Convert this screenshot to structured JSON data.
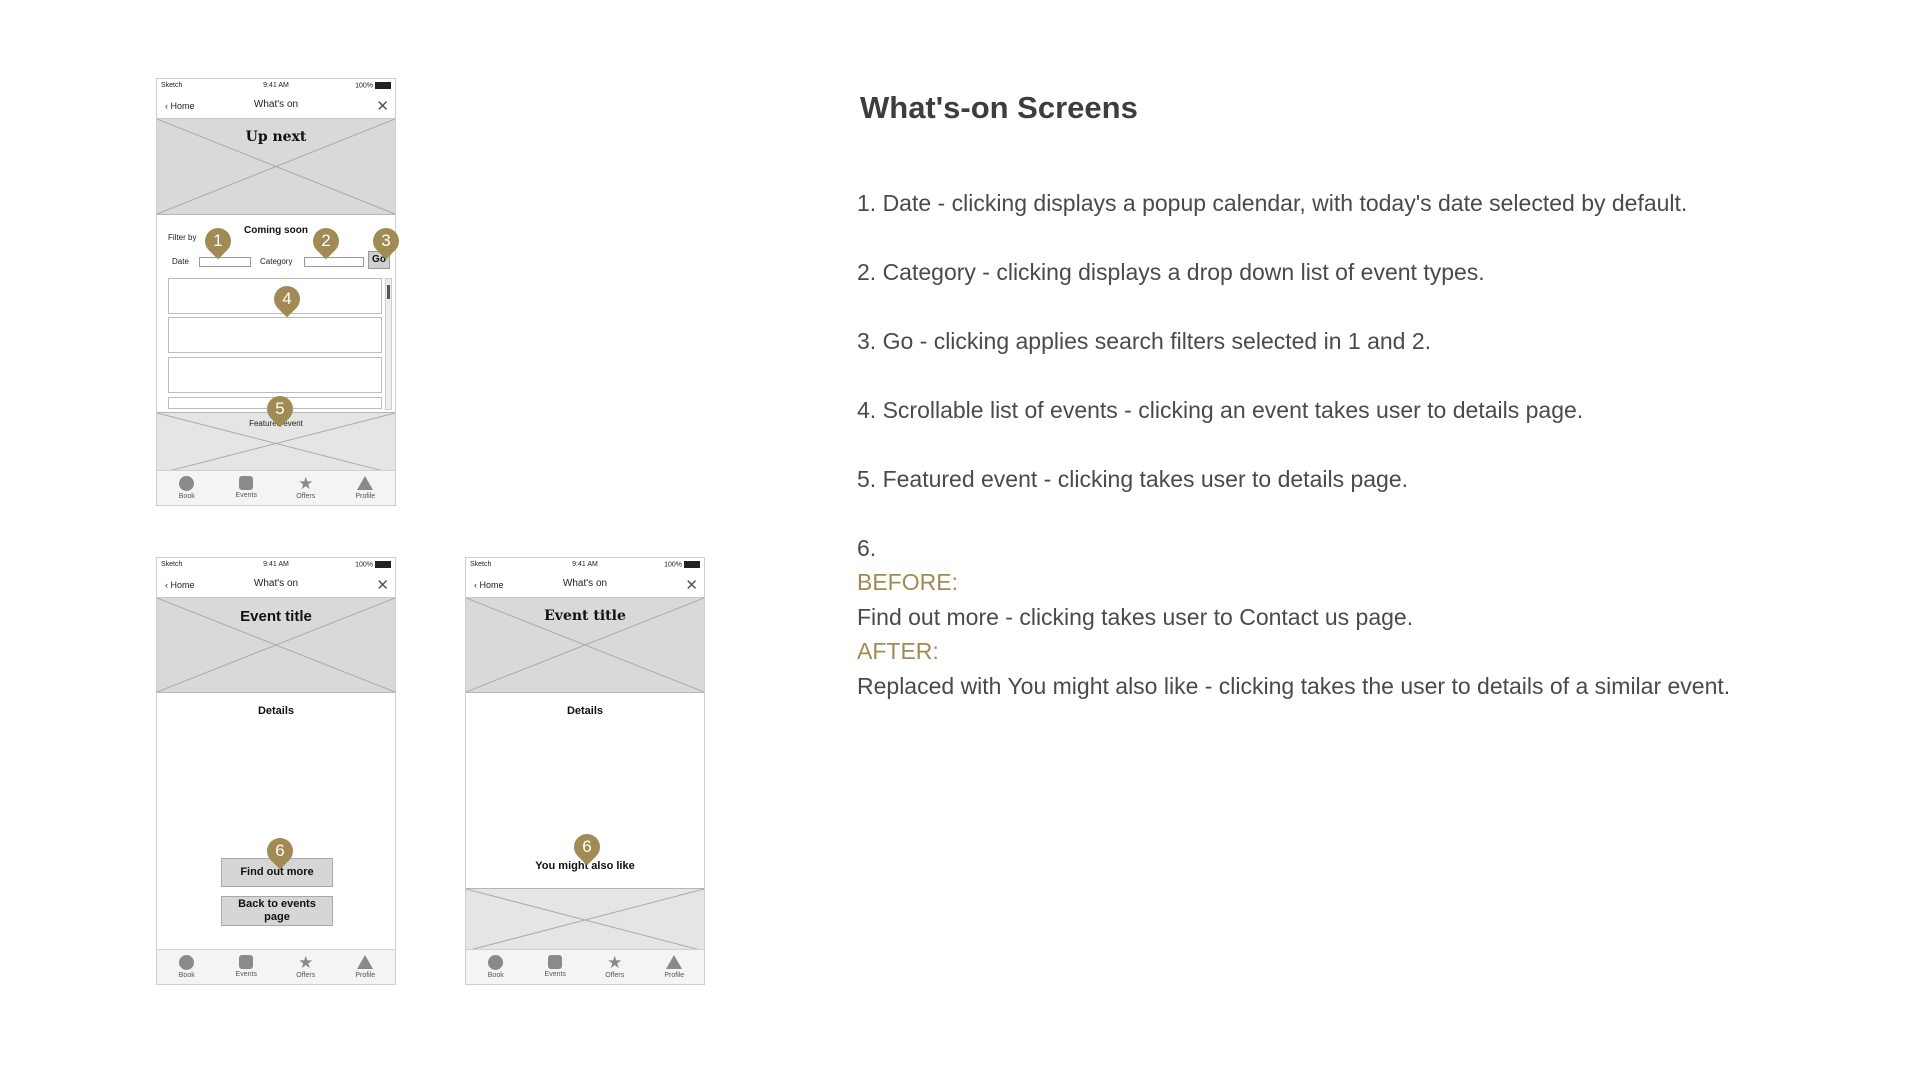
{
  "status_bar": {
    "carrier": "Sketch",
    "time": "9:41 AM",
    "battery": "100%"
  },
  "nav": {
    "back_label": "Home",
    "title": "What's on",
    "close": "✕"
  },
  "tabs": [
    {
      "label": "Book",
      "icon": "circle-icon"
    },
    {
      "label": "Events",
      "icon": "square-icon"
    },
    {
      "label": "Offers",
      "icon": "star-icon"
    },
    {
      "label": "Profile",
      "icon": "triangle-icon"
    }
  ],
  "screen1": {
    "hero_title": "Up next",
    "coming_soon": "Coming soon",
    "filter_by": "Filter by",
    "date_label": "Date",
    "category_label": "Category",
    "go_label": "Go",
    "featured_label": "Featured event"
  },
  "screen2": {
    "hero_title": "Event title",
    "details_label": "Details",
    "find_out_more": "Find out more",
    "back_to_events": "Back to events page"
  },
  "screen3": {
    "hero_title": "Event title",
    "details_label": "Details",
    "you_might_like": "You might also like"
  },
  "markers": [
    "1",
    "2",
    "3",
    "4",
    "5",
    "6"
  ],
  "marker_color": "#a08b55",
  "annotations": {
    "title": "What's-on Screens",
    "items": [
      "1. Date - clicking displays a popup calendar, with today's date selected by default.",
      "2. Category - clicking displays a drop down list of event types.",
      "3. Go - clicking applies search filters selected in 1 and 2.",
      "4. Scrollable list of events - clicking an event takes user to details page.",
      "5. Featured event - clicking takes user to details page."
    ],
    "item6_number": "6.",
    "before_label": "BEFORE:",
    "before_text": "Find out more - clicking takes user to Contact us page.",
    "after_label": "AFTER:",
    "after_text": "Replaced with You might also like - clicking takes the user to details of a similar event."
  }
}
